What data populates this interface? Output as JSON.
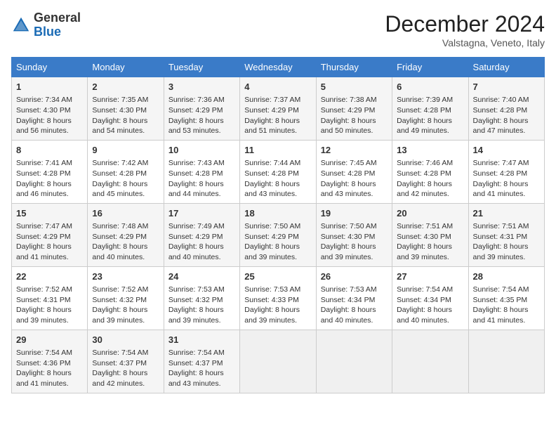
{
  "logo": {
    "line1": "General",
    "line2": "Blue"
  },
  "title": "December 2024",
  "location": "Valstagna, Veneto, Italy",
  "weekdays": [
    "Sunday",
    "Monday",
    "Tuesday",
    "Wednesday",
    "Thursday",
    "Friday",
    "Saturday"
  ],
  "weeks": [
    [
      {
        "day": "1",
        "sunrise": "Sunrise: 7:34 AM",
        "sunset": "Sunset: 4:30 PM",
        "daylight": "Daylight: 8 hours and 56 minutes."
      },
      {
        "day": "2",
        "sunrise": "Sunrise: 7:35 AM",
        "sunset": "Sunset: 4:30 PM",
        "daylight": "Daylight: 8 hours and 54 minutes."
      },
      {
        "day": "3",
        "sunrise": "Sunrise: 7:36 AM",
        "sunset": "Sunset: 4:29 PM",
        "daylight": "Daylight: 8 hours and 53 minutes."
      },
      {
        "day": "4",
        "sunrise": "Sunrise: 7:37 AM",
        "sunset": "Sunset: 4:29 PM",
        "daylight": "Daylight: 8 hours and 51 minutes."
      },
      {
        "day": "5",
        "sunrise": "Sunrise: 7:38 AM",
        "sunset": "Sunset: 4:29 PM",
        "daylight": "Daylight: 8 hours and 50 minutes."
      },
      {
        "day": "6",
        "sunrise": "Sunrise: 7:39 AM",
        "sunset": "Sunset: 4:28 PM",
        "daylight": "Daylight: 8 hours and 49 minutes."
      },
      {
        "day": "7",
        "sunrise": "Sunrise: 7:40 AM",
        "sunset": "Sunset: 4:28 PM",
        "daylight": "Daylight: 8 hours and 47 minutes."
      }
    ],
    [
      {
        "day": "8",
        "sunrise": "Sunrise: 7:41 AM",
        "sunset": "Sunset: 4:28 PM",
        "daylight": "Daylight: 8 hours and 46 minutes."
      },
      {
        "day": "9",
        "sunrise": "Sunrise: 7:42 AM",
        "sunset": "Sunset: 4:28 PM",
        "daylight": "Daylight: 8 hours and 45 minutes."
      },
      {
        "day": "10",
        "sunrise": "Sunrise: 7:43 AM",
        "sunset": "Sunset: 4:28 PM",
        "daylight": "Daylight: 8 hours and 44 minutes."
      },
      {
        "day": "11",
        "sunrise": "Sunrise: 7:44 AM",
        "sunset": "Sunset: 4:28 PM",
        "daylight": "Daylight: 8 hours and 43 minutes."
      },
      {
        "day": "12",
        "sunrise": "Sunrise: 7:45 AM",
        "sunset": "Sunset: 4:28 PM",
        "daylight": "Daylight: 8 hours and 43 minutes."
      },
      {
        "day": "13",
        "sunrise": "Sunrise: 7:46 AM",
        "sunset": "Sunset: 4:28 PM",
        "daylight": "Daylight: 8 hours and 42 minutes."
      },
      {
        "day": "14",
        "sunrise": "Sunrise: 7:47 AM",
        "sunset": "Sunset: 4:28 PM",
        "daylight": "Daylight: 8 hours and 41 minutes."
      }
    ],
    [
      {
        "day": "15",
        "sunrise": "Sunrise: 7:47 AM",
        "sunset": "Sunset: 4:29 PM",
        "daylight": "Daylight: 8 hours and 41 minutes."
      },
      {
        "day": "16",
        "sunrise": "Sunrise: 7:48 AM",
        "sunset": "Sunset: 4:29 PM",
        "daylight": "Daylight: 8 hours and 40 minutes."
      },
      {
        "day": "17",
        "sunrise": "Sunrise: 7:49 AM",
        "sunset": "Sunset: 4:29 PM",
        "daylight": "Daylight: 8 hours and 40 minutes."
      },
      {
        "day": "18",
        "sunrise": "Sunrise: 7:50 AM",
        "sunset": "Sunset: 4:29 PM",
        "daylight": "Daylight: 8 hours and 39 minutes."
      },
      {
        "day": "19",
        "sunrise": "Sunrise: 7:50 AM",
        "sunset": "Sunset: 4:30 PM",
        "daylight": "Daylight: 8 hours and 39 minutes."
      },
      {
        "day": "20",
        "sunrise": "Sunrise: 7:51 AM",
        "sunset": "Sunset: 4:30 PM",
        "daylight": "Daylight: 8 hours and 39 minutes."
      },
      {
        "day": "21",
        "sunrise": "Sunrise: 7:51 AM",
        "sunset": "Sunset: 4:31 PM",
        "daylight": "Daylight: 8 hours and 39 minutes."
      }
    ],
    [
      {
        "day": "22",
        "sunrise": "Sunrise: 7:52 AM",
        "sunset": "Sunset: 4:31 PM",
        "daylight": "Daylight: 8 hours and 39 minutes."
      },
      {
        "day": "23",
        "sunrise": "Sunrise: 7:52 AM",
        "sunset": "Sunset: 4:32 PM",
        "daylight": "Daylight: 8 hours and 39 minutes."
      },
      {
        "day": "24",
        "sunrise": "Sunrise: 7:53 AM",
        "sunset": "Sunset: 4:32 PM",
        "daylight": "Daylight: 8 hours and 39 minutes."
      },
      {
        "day": "25",
        "sunrise": "Sunrise: 7:53 AM",
        "sunset": "Sunset: 4:33 PM",
        "daylight": "Daylight: 8 hours and 39 minutes."
      },
      {
        "day": "26",
        "sunrise": "Sunrise: 7:53 AM",
        "sunset": "Sunset: 4:34 PM",
        "daylight": "Daylight: 8 hours and 40 minutes."
      },
      {
        "day": "27",
        "sunrise": "Sunrise: 7:54 AM",
        "sunset": "Sunset: 4:34 PM",
        "daylight": "Daylight: 8 hours and 40 minutes."
      },
      {
        "day": "28",
        "sunrise": "Sunrise: 7:54 AM",
        "sunset": "Sunset: 4:35 PM",
        "daylight": "Daylight: 8 hours and 41 minutes."
      }
    ],
    [
      {
        "day": "29",
        "sunrise": "Sunrise: 7:54 AM",
        "sunset": "Sunset: 4:36 PM",
        "daylight": "Daylight: 8 hours and 41 minutes."
      },
      {
        "day": "30",
        "sunrise": "Sunrise: 7:54 AM",
        "sunset": "Sunset: 4:37 PM",
        "daylight": "Daylight: 8 hours and 42 minutes."
      },
      {
        "day": "31",
        "sunrise": "Sunrise: 7:54 AM",
        "sunset": "Sunset: 4:37 PM",
        "daylight": "Daylight: 8 hours and 43 minutes."
      },
      null,
      null,
      null,
      null
    ]
  ]
}
